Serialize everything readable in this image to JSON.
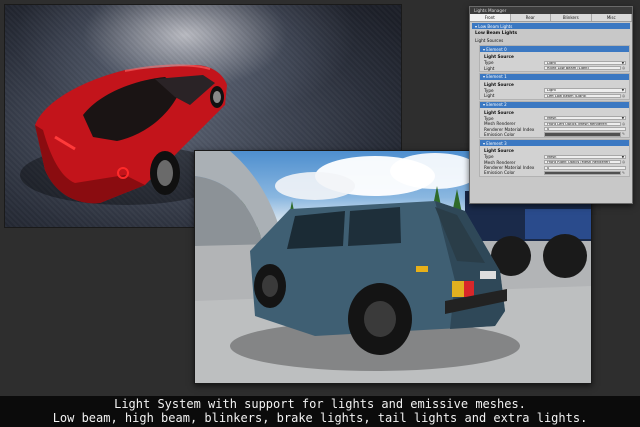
{
  "inspector": {
    "window_title": "Lights Manager",
    "tabs": [
      "Front",
      "Rear",
      "Blinkers",
      "Misc"
    ],
    "active_tab": "Front",
    "section_label": "Low Beam Lights",
    "heading": "Low Beam Lights",
    "light_sources_label": "Light Sources",
    "elements": [
      {
        "label": "Element 0",
        "header": "Light Source",
        "rows": [
          {
            "label": "Type",
            "value": "Light"
          },
          {
            "label": "Light",
            "value": "Right Low Beam (Light)"
          }
        ]
      },
      {
        "label": "Element 1",
        "header": "Light Source",
        "rows": [
          {
            "label": "Type",
            "value": "Light"
          },
          {
            "label": "Light",
            "value": "Left Low Beam (Light)"
          }
        ]
      },
      {
        "label": "Element 2",
        "header": "Light Source",
        "rows": [
          {
            "label": "Type",
            "value": "Mesh"
          },
          {
            "label": "Mesh Renderer",
            "value": "Front Left Optics (Mesh Renderer)"
          },
          {
            "label": "Renderer Material Index",
            "value": "0"
          },
          {
            "label": "Emission Color",
            "value": ""
          }
        ]
      },
      {
        "label": "Element 3",
        "header": "Light Source",
        "rows": [
          {
            "label": "Type",
            "value": "Mesh"
          },
          {
            "label": "Mesh Renderer",
            "value": "Front Right Optics (Mesh Renderer)"
          },
          {
            "label": "Renderer Material Index",
            "value": "0"
          },
          {
            "label": "Emission Color",
            "value": ""
          }
        ]
      }
    ]
  },
  "caption": {
    "line1": "Light System with support for lights and emissive meshes.",
    "line2": "Low beam, high beam, blinkers, brake lights, tail lights and extra lights."
  },
  "colors": {
    "accent_blue": "#3b78c2",
    "red_car": "#c8141c",
    "blue_car": "#3f5f73"
  }
}
